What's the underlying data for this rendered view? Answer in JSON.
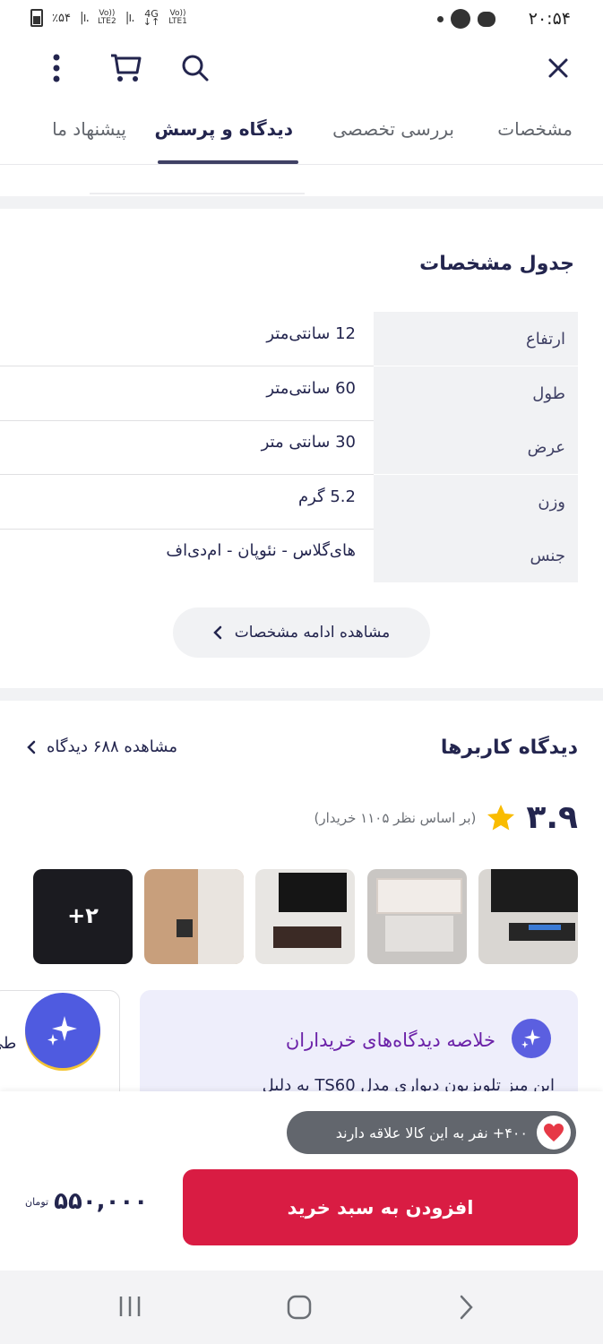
{
  "status_bar": {
    "time": "۲۰:۵۴",
    "battery": "٪۵۴",
    "net1": "Vo))\nLTE2",
    "net2": "4G",
    "net3": "Vo))\nLTE1"
  },
  "toolbar": {
    "close_icon": "close-icon",
    "search_icon": "search-icon",
    "cart_icon": "cart-icon",
    "more_icon": "more-vertical-icon"
  },
  "tabs": [
    {
      "label": "مشخصات"
    },
    {
      "label": "بررسی تخصصی"
    },
    {
      "label": "دیدگاه و پرسش",
      "active": true
    },
    {
      "label": "پیشنهاد ما"
    }
  ],
  "specs": {
    "title": "جدول مشخصات",
    "rows": [
      {
        "key": "ارتفاع",
        "value": "12 سانتی‌متر"
      },
      {
        "key": "طول",
        "value": "60 سانتی‌متر"
      },
      {
        "key": "عرض",
        "value": "30 سانتی متر"
      },
      {
        "key": "وزن",
        "value": "5.2 گرم"
      },
      {
        "key": "جنس",
        "value": "های‌گلاس - نئوپان - ام‌دی‌اف"
      }
    ],
    "more_label": "مشاهده ادامه مشخصات"
  },
  "reviews": {
    "title": "دیدگاه کاربرها",
    "view_all": "مشاهده ۶۸۸ دیدگاه",
    "rating": "۳.۹",
    "rating_sub": "(بر اساس نظر ۱۱۰۵ خریدار)",
    "more_photos": "+۲",
    "summary_title": "خلاصه دیدگاه‌های خریداران",
    "summary_body": "این میز تلویزیون دیواری مدل TS60 به دلیل",
    "side_text": "طی"
  },
  "bottom": {
    "interest": "۴۰۰+ نفر به این کالا علاقه دارند",
    "add_to_cart": "افزودن به سبد خرید",
    "price": "۵۵۰,۰۰۰",
    "currency": "تومان"
  },
  "colors": {
    "primary": "#d91c43",
    "text": "#23254e",
    "muted": "#62666d",
    "ai_purple": "#6b21a8",
    "star": "#f9bc00"
  }
}
